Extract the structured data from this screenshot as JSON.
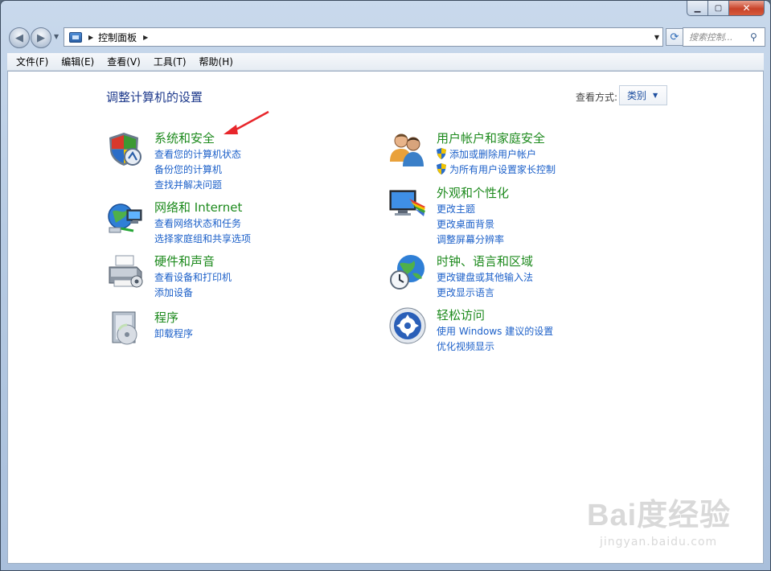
{
  "window": {
    "caption_buttons": {
      "minimize": "minimize-icon",
      "maximize": "maximize-icon",
      "close": "close-icon"
    }
  },
  "nav": {
    "breadcrumb": [
      "控制面板"
    ],
    "search_placeholder": "搜索控制..."
  },
  "menu": [
    "文件(F)",
    "编辑(E)",
    "查看(V)",
    "工具(T)",
    "帮助(H)"
  ],
  "content": {
    "title": "调整计算机的设置",
    "view_label": "查看方式:",
    "view_value": "类别"
  },
  "categories": [
    {
      "title": "系统和安全",
      "icon": "shield-icon",
      "links": [
        "查看您的计算机状态",
        "备份您的计算机",
        "查找并解决问题"
      ]
    },
    {
      "title": "网络和 Internet",
      "icon": "network-globe-icon",
      "links": [
        "查看网络状态和任务",
        "选择家庭组和共享选项"
      ]
    },
    {
      "title": "硬件和声音",
      "icon": "printer-icon",
      "links": [
        "查看设备和打印机",
        "添加设备"
      ]
    },
    {
      "title": "程序",
      "icon": "programs-disc-icon",
      "links": [
        "卸载程序"
      ]
    },
    {
      "title": "用户帐户和家庭安全",
      "icon": "users-icon",
      "links": [
        "添加或删除用户帐户",
        "为所有用户设置家长控制"
      ]
    },
    {
      "title": "外观和个性化",
      "icon": "monitor-palette-icon",
      "links": [
        "更改主题",
        "更改桌面背景",
        "调整屏幕分辨率"
      ]
    },
    {
      "title": "时钟、语言和区域",
      "icon": "clock-globe-icon",
      "links": [
        "更改键盘或其他输入法",
        "更改显示语言"
      ]
    },
    {
      "title": "轻松访问",
      "icon": "ease-of-access-icon",
      "links": [
        "使用 Windows 建议的设置",
        "优化视频显示"
      ]
    }
  ],
  "watermark": {
    "main": "Bai度经验",
    "sub": "jingyan.baidu.com"
  },
  "colors": {
    "category_title": "#1d8a1d",
    "link": "#1c60c9",
    "page_title": "#1e3a8c"
  }
}
